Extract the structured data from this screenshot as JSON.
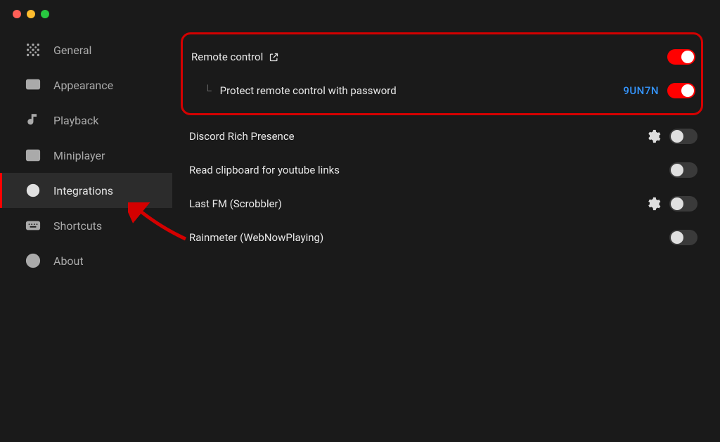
{
  "sidebar": {
    "items": [
      {
        "label": "General",
        "icon": "grid"
      },
      {
        "label": "Appearance",
        "icon": "monitor"
      },
      {
        "label": "Playback",
        "icon": "music"
      },
      {
        "label": "Miniplayer",
        "icon": "pip"
      },
      {
        "label": "Integrations",
        "icon": "target",
        "active": true
      },
      {
        "label": "Shortcuts",
        "icon": "keyboard"
      },
      {
        "label": "About",
        "icon": "info"
      }
    ]
  },
  "integrations": {
    "remote_control": {
      "label": "Remote control",
      "enabled": true,
      "password_protect": {
        "label": "Protect remote control with password",
        "code": "9UN7N",
        "enabled": true
      }
    },
    "discord": {
      "label": "Discord Rich Presence",
      "has_settings": true,
      "enabled": false
    },
    "clipboard": {
      "label": "Read clipboard for youtube links",
      "enabled": false
    },
    "lastfm": {
      "label": "Last FM (Scrobbler)",
      "has_settings": true,
      "enabled": false
    },
    "rainmeter": {
      "label": "Rainmeter (WebNowPlaying)",
      "enabled": false
    }
  },
  "colors": {
    "accent": "#ff0000",
    "highlight_border": "#d40000",
    "link": "#3596ff"
  }
}
